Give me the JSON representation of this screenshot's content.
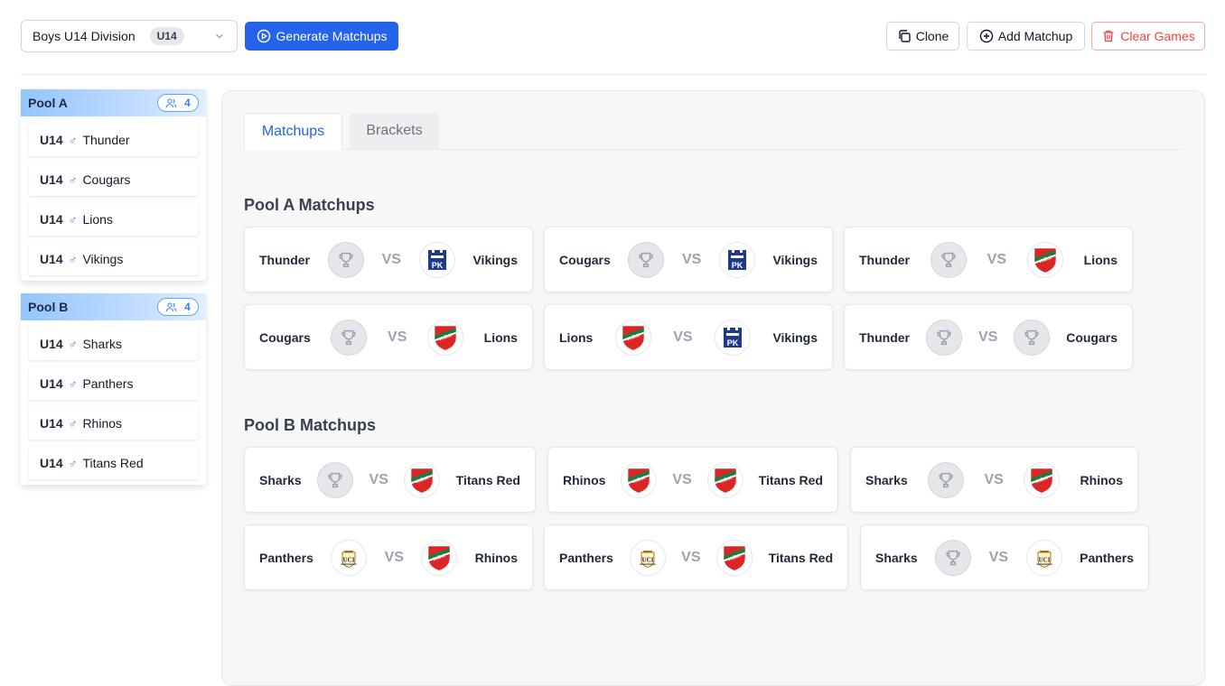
{
  "toolbar": {
    "division_label": "Boys U14 Division",
    "division_badge": "U14",
    "generate_label": "Generate Matchups",
    "clone_label": "Clone",
    "add_label": "Add Matchup",
    "clear_label": "Clear Games"
  },
  "pools": [
    {
      "name": "Pool A",
      "count": "4",
      "teams": [
        {
          "age": "U14",
          "gender": "♂",
          "name": "Thunder"
        },
        {
          "age": "U14",
          "gender": "♂",
          "name": "Cougars"
        },
        {
          "age": "U14",
          "gender": "♂",
          "name": "Lions"
        },
        {
          "age": "U14",
          "gender": "♂",
          "name": "Vikings"
        }
      ]
    },
    {
      "name": "Pool B",
      "count": "4",
      "teams": [
        {
          "age": "U14",
          "gender": "♂",
          "name": "Sharks"
        },
        {
          "age": "U14",
          "gender": "♂",
          "name": "Panthers"
        },
        {
          "age": "U14",
          "gender": "♂",
          "name": "Rhinos"
        },
        {
          "age": "U14",
          "gender": "♂",
          "name": "Titans Red"
        }
      ]
    }
  ],
  "tabs": {
    "matchups": "Matchups",
    "brackets": "Brackets"
  },
  "vs_label": "VS",
  "sections": [
    {
      "title": "Pool A Matchups",
      "matchups": [
        {
          "home": "Thunder",
          "home_logo": "trophy",
          "away": "Vikings",
          "away_logo": "vikings"
        },
        {
          "home": "Cougars",
          "home_logo": "trophy",
          "away": "Vikings",
          "away_logo": "vikings"
        },
        {
          "home": "Thunder",
          "home_logo": "trophy",
          "away": "Lions",
          "away_logo": "ksk"
        },
        {
          "home": "Cougars",
          "home_logo": "trophy",
          "away": "Lions",
          "away_logo": "ksk"
        },
        {
          "home": "Lions",
          "home_logo": "ksk",
          "away": "Vikings",
          "away_logo": "vikings"
        },
        {
          "home": "Thunder",
          "home_logo": "trophy",
          "away": "Cougars",
          "away_logo": "trophy"
        }
      ]
    },
    {
      "title": "Pool B Matchups",
      "matchups": [
        {
          "home": "Sharks",
          "home_logo": "trophy",
          "away": "Titans Red",
          "away_logo": "ksk"
        },
        {
          "home": "Rhinos",
          "home_logo": "ksk",
          "away": "Titans Red",
          "away_logo": "ksk"
        },
        {
          "home": "Sharks",
          "home_logo": "trophy",
          "away": "Rhinos",
          "away_logo": "ksk"
        },
        {
          "home": "Panthers",
          "home_logo": "crest",
          "away": "Rhinos",
          "away_logo": "ksk"
        },
        {
          "home": "Panthers",
          "home_logo": "crest",
          "away": "Titans Red",
          "away_logo": "ksk"
        },
        {
          "home": "Sharks",
          "home_logo": "trophy",
          "away": "Panthers",
          "away_logo": "crest"
        }
      ]
    }
  ],
  "colors": {
    "accent": "#2563eb",
    "danger": "#ef4444",
    "pool_header": "#93c5fd"
  }
}
